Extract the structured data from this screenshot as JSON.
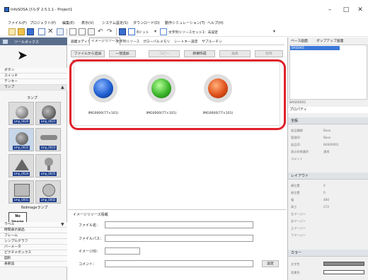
{
  "window": {
    "title": "InfoSOSA びルダ 2.5.1.1 - Project1",
    "buttons": [
      "–",
      "□",
      "✕"
    ]
  },
  "menu": [
    "ファイル(F)",
    "プロジェクト(P)",
    "編集(E)",
    "表示(V)",
    "システム設定(S)",
    "ダウンロード(D)",
    "動作シミュレーション(T)",
    "ヘルプ(H)"
  ],
  "toolbar": {
    "field_value": "8ドット",
    "text_resource_set": "文字列リソースセット1：未設定"
  },
  "toolbox": {
    "title": "ツールボックス",
    "categories_top": [
      "ボタン",
      "スイッチ",
      "テンキー",
      "ランプ"
    ],
    "section_title": "ランプ",
    "lamps": [
      "Lmp_0020",
      "Lmp_0021",
      "Lmp_0022",
      "Lmp_0023",
      "Lmp_0024",
      "Lmp_0025",
      "Lmp_0001",
      "Lmp_0002"
    ],
    "noimage_label": "NoImageランプ",
    "noimage_box": "No Image",
    "categories_bottom": [
      "ラベル",
      "時間表示部品",
      "フレーム",
      "シンプルグラフ",
      "バーメータ",
      "ピクチャボックス",
      "図形",
      "表部品"
    ]
  },
  "tabs": [
    "画面エディタ",
    "イメージリソース",
    "文字列リソース",
    "グローバルメモリ",
    "シートキー設定",
    "サブルーチン"
  ],
  "resource_buttons": [
    "ファイルから追加",
    "一括追加",
    "コピー",
    "新規作成",
    "編集",
    "削除"
  ],
  "images": [
    {
      "caption": "IMG0000(77×101)",
      "color": "#1f5fd0"
    },
    {
      "caption": "IMG0000(77×101)",
      "color": "#3bb52a"
    },
    {
      "caption": "IMG0000(77×101)",
      "color": "#e0501a"
    }
  ],
  "info": {
    "title": "イメージリソース情報",
    "fields": [
      "ファイル名：",
      "ファイルパス：",
      "イメージID：",
      "コメント："
    ],
    "apply_button": "設定"
  },
  "right": {
    "tabs": [
      "ベース画面",
      "ポップアップ画面"
    ],
    "base_item": "BAS0001",
    "selected_label": "BAS00001",
    "property_title": "プロパティ",
    "sections": [
      "全般",
      "レイアウト",
      "カラー"
    ],
    "general_props": [
      {
        "name": "部品種類",
        "value": "Base"
      },
      {
        "name": "管理ID",
        "value": "Base"
      },
      {
        "name": "部品ID",
        "value": "BAS00001"
      },
      {
        "name": "表示状態選択",
        "value": "通常"
      },
      {
        "name": "コメント",
        "value": ""
      }
    ],
    "layout_props": [
      {
        "name": "横位置",
        "value": "0"
      },
      {
        "name": "縦位置",
        "value": "0"
      },
      {
        "name": "幅",
        "value": "480"
      },
      {
        "name": "高さ",
        "value": "272"
      },
      {
        "name": "左マージン",
        "value": ""
      },
      {
        "name": "右マージン",
        "value": ""
      },
      {
        "name": "上マージン",
        "value": ""
      },
      {
        "name": "下マージン",
        "value": ""
      }
    ],
    "color_props": [
      {
        "name": "文字色",
        "value": ""
      },
      {
        "name": "背景色",
        "value": ""
      }
    ]
  }
}
